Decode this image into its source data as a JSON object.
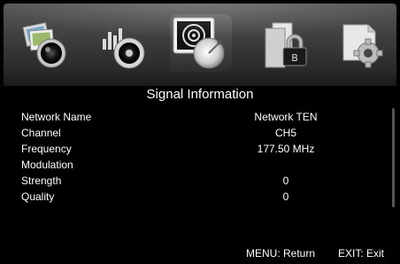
{
  "menu": {
    "icons": [
      {
        "name": "picture-icon"
      },
      {
        "name": "sound-icon"
      },
      {
        "name": "channel-search-icon",
        "selected": true
      },
      {
        "name": "lock-icon"
      },
      {
        "name": "settings-icon"
      }
    ]
  },
  "page": {
    "title": "Signal Information"
  },
  "signal_info": {
    "rows": [
      {
        "label": "Network Name",
        "value": "Network TEN"
      },
      {
        "label": "Channel",
        "value": "CH5"
      },
      {
        "label": "Frequency",
        "value": "177.50 MHz"
      },
      {
        "label": "Modulation",
        "value": ""
      },
      {
        "label": "Strength",
        "value": "0"
      },
      {
        "label": "Quality",
        "value": "0"
      }
    ]
  },
  "footer": {
    "menu_hint": "MENU: Return",
    "exit_hint": "EXIT: Exit"
  },
  "colors": {
    "background": "#000000",
    "text": "#ffffff",
    "icon_bar": "#3c3c3c"
  }
}
